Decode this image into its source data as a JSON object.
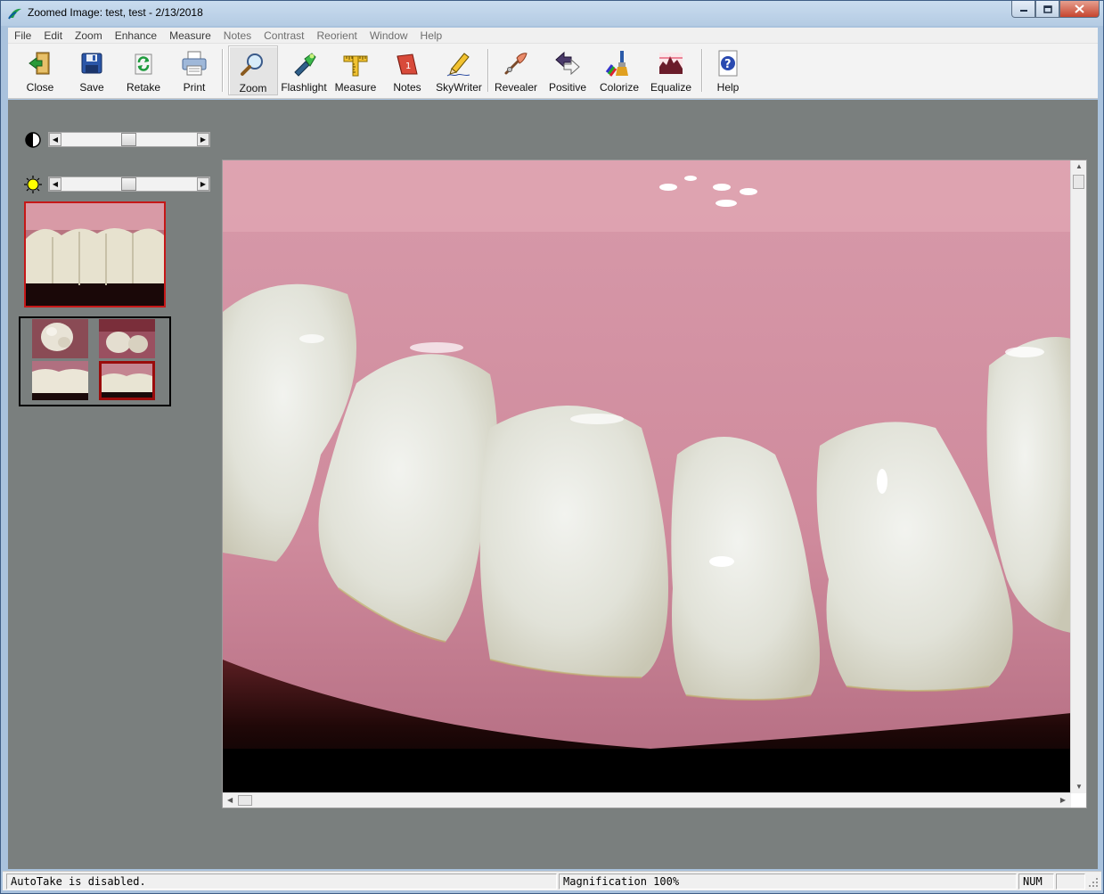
{
  "window": {
    "title": "Zoomed Image: test, test - 2/13/2018",
    "controls": [
      "minimize-icon",
      "maximize-icon",
      "close-icon"
    ]
  },
  "menu": [
    "File",
    "Edit",
    "Zoom",
    "Enhance",
    "Measure",
    "Notes",
    "Contrast",
    "Reorient",
    "Window",
    "Help"
  ],
  "toolbar": {
    "close": "Close",
    "save": "Save",
    "retake": "Retake",
    "print": "Print",
    "zoom": "Zoom",
    "flashlight": "Flashlight",
    "measure": "Measure",
    "notes": "Notes",
    "skywriter": "SkyWriter",
    "revealer": "Revealer",
    "positive": "Positive",
    "colorize": "Colorize",
    "equalize": "Equalize",
    "help": "Help",
    "active_tool": "Zoom"
  },
  "controls": {
    "contrast_icon": "contrast-icon",
    "contrast_level": 0.5,
    "brightness_icon": "brightness-sun-icon",
    "brightness_level": 0.5
  },
  "thumbnails": {
    "count": 4,
    "selected_index": 3,
    "selected_color": "#9a0b0b"
  },
  "image": {
    "subject": "intraoral dental photograph"
  },
  "status": {
    "message": "AutoTake is disabled.",
    "magnification": "Magnification 100%",
    "num": "NUM"
  },
  "colors": {
    "client_bg": "#7a7f7e",
    "selected_border": "#c51818",
    "sun": "#ffff00"
  }
}
